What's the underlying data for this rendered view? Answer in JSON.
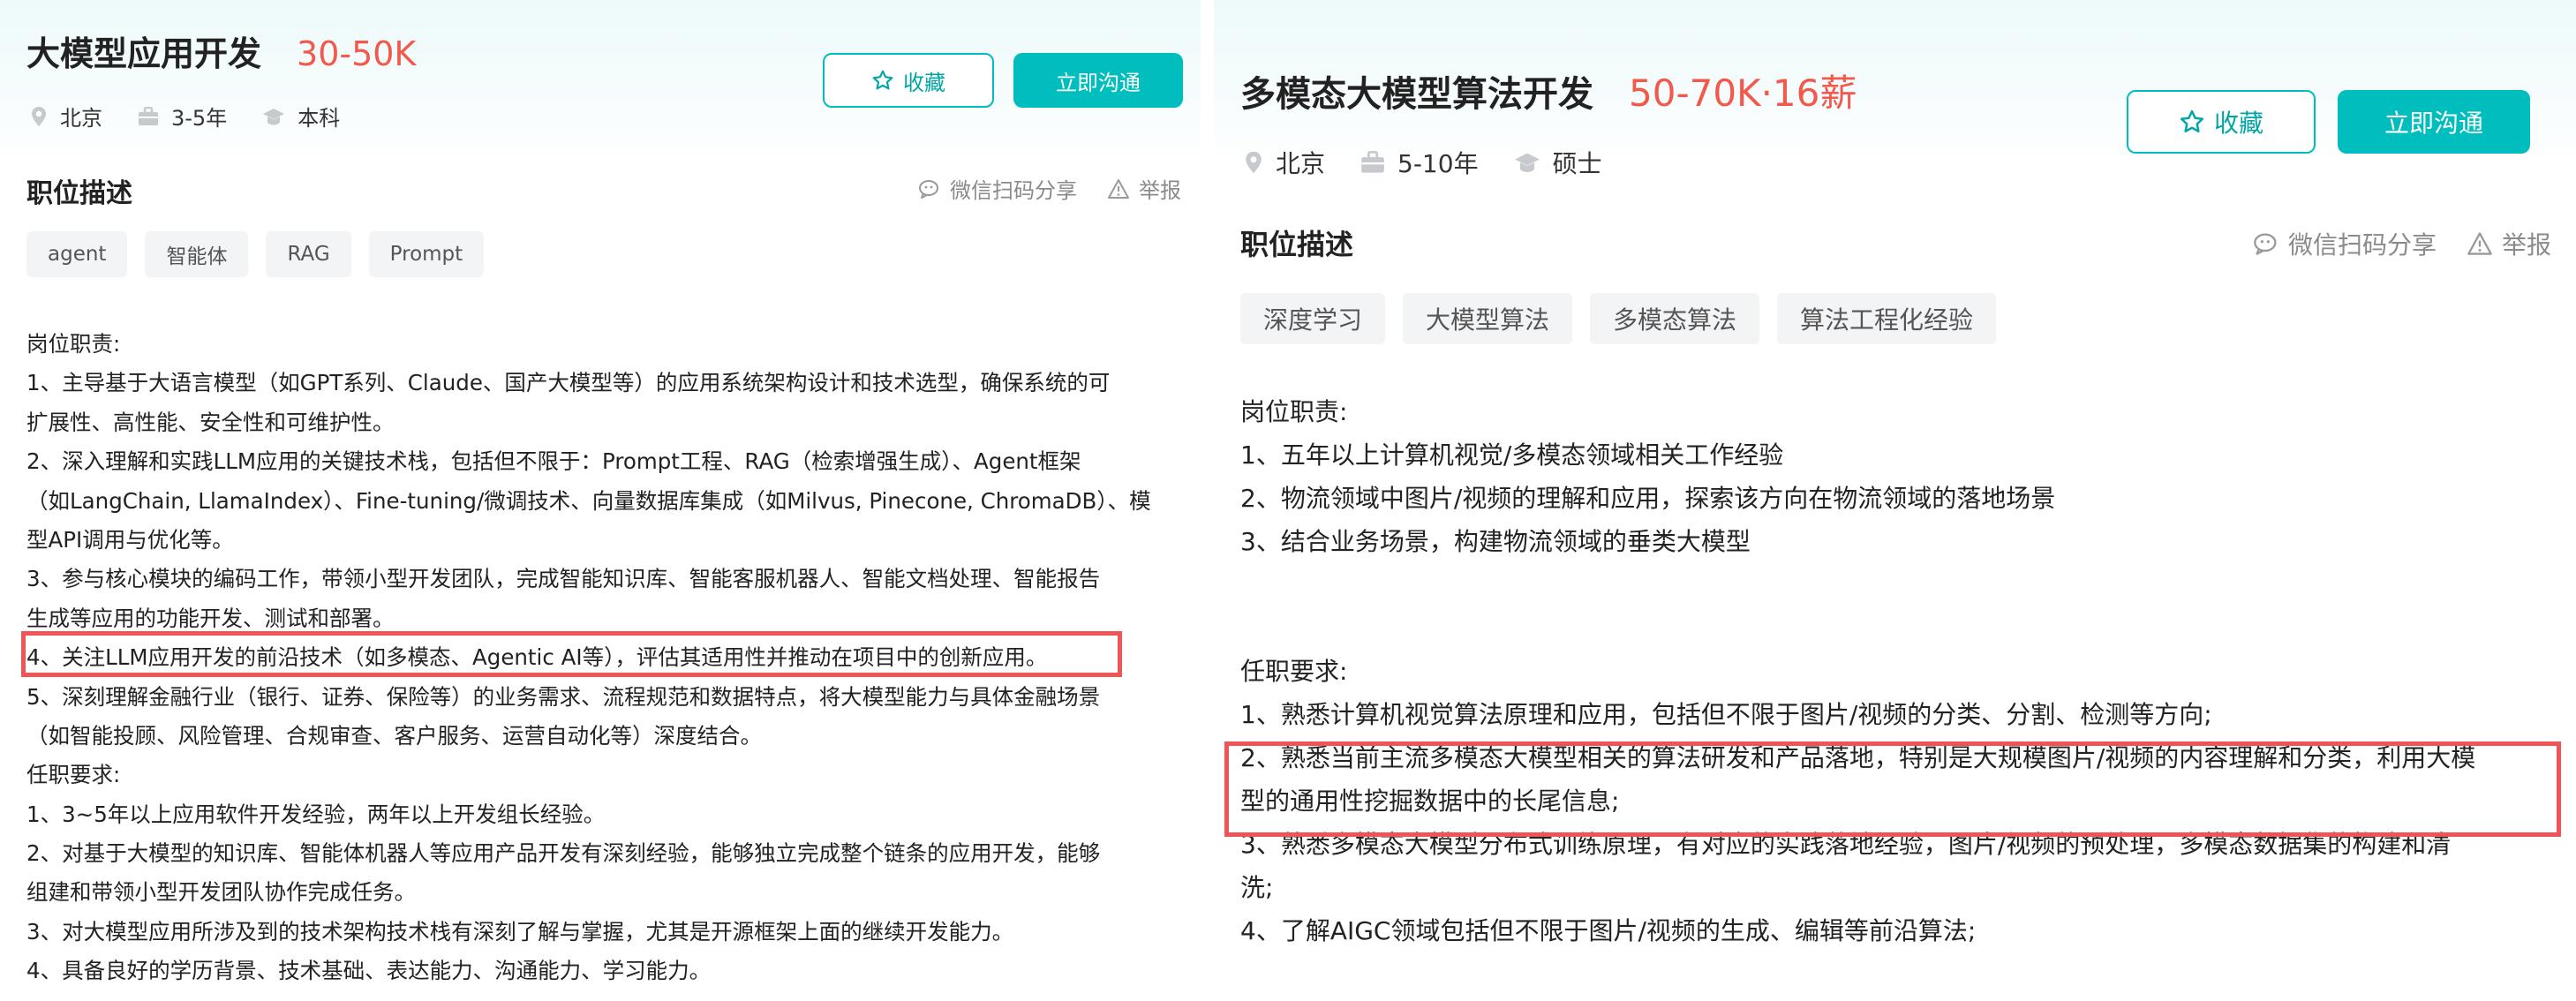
{
  "left": {
    "job_title": "大模型应用开发",
    "salary": "30-50K",
    "meta": [
      {
        "icon": "location-pin-icon",
        "text": "北京"
      },
      {
        "icon": "briefcase-icon",
        "text": "3-5年"
      },
      {
        "icon": "graduation-cap-icon",
        "text": "本科"
      }
    ],
    "buttons": {
      "favorite": "收藏",
      "chat": "立即沟通"
    },
    "section_title": "职位描述",
    "share_label": "微信扫码分享",
    "report_label": "举报",
    "tags": [
      "agent",
      "智能体",
      "RAG",
      "Prompt"
    ],
    "lines": [
      "岗位职责:",
      "1、主导基于大语言模型（如GPT系列、Claude、国产大模型等）的应用系统架构设计和技术选型，确保系统的可",
      "扩展性、高性能、安全性和可维护性。",
      "2、深入理解和实践LLM应用的关键技术栈，包括但不限于：Prompt工程、RAG（检索增强生成）、Agent框架",
      "（如LangChain, LlamaIndex）、Fine-tuning/微调技术、向量数据库集成（如Milvus, Pinecone, ChromaDB）、模",
      "型API调用与优化等。",
      "3、参与核心模块的编码工作，带领小型开发团队，完成智能知识库、智能客服机器人、智能文档处理、智能报告",
      "生成等应用的功能开发、测试和部署。",
      "4、关注LLM应用开发的前沿技术（如多模态、Agentic AI等），评估其适用性并推动在项目中的创新应用。",
      "5、深刻理解金融行业（银行、证券、保险等）的业务需求、流程规范和数据特点，将大模型能力与具体金融场景",
      "（如智能投顾、风险管理、合规审查、客户服务、运营自动化等）深度结合。",
      "任职要求:",
      "1、3~5年以上应用软件开发经验，两年以上开发组长经验。",
      "2、对基于大模型的知识库、智能体机器人等应用产品开发有深刻经验，能够独立完成整个链条的应用开发，能够",
      "组建和带领小型开发团队协作完成任务。",
      "3、对大模型应用所涉及到的技术架构技术栈有深刻了解与掌握，尤其是开源框架上面的继续开发能力。",
      "4、具备良好的学历背景、技术基础、表达能力、沟通能力、学习能力。"
    ]
  },
  "right": {
    "job_title": "多模态大模型算法开发",
    "salary": "50-70K·16薪",
    "meta": [
      {
        "icon": "location-pin-icon",
        "text": "北京"
      },
      {
        "icon": "briefcase-icon",
        "text": "5-10年"
      },
      {
        "icon": "graduation-cap-icon",
        "text": "硕士"
      }
    ],
    "buttons": {
      "favorite": "收藏",
      "chat": "立即沟通"
    },
    "section_title": "职位描述",
    "share_label": "微信扫码分享",
    "report_label": "举报",
    "tags": [
      "深度学习",
      "大模型算法",
      "多模态算法",
      "算法工程化经验"
    ],
    "lines": [
      "岗位职责:",
      "1、五年以上计算机视觉/多模态领域相关工作经验",
      "2、物流领域中图片/视频的理解和应用，探索该方向在物流领域的落地场景",
      "3、结合业务场景，构建物流领域的垂类大模型",
      "",
      "",
      "任职要求:",
      "1、熟悉计算机视觉算法原理和应用，包括但不限于图片/视频的分类、分割、检测等方向;",
      "2、熟悉当前主流多模态大模型相关的算法研发和产品落地，特别是大规模图片/视频的内容理解和分类，利用大模",
      "型的通用性挖掘数据中的长尾信息;",
      "3、熟悉多模态大模型分布式训练原理，有对应的实践落地经验，图片/视频的预处理，多模态数据集的构建和清",
      "洗;",
      "4、了解AIGC领域包括但不限于图片/视频的生成、编辑等前沿算法;"
    ]
  },
  "colors": {
    "accent": "#00bebd",
    "salary": "#f2594b",
    "highlight_box": "#f05454",
    "tag_bg": "#f3f4f6",
    "muted": "#8a8a8a"
  }
}
